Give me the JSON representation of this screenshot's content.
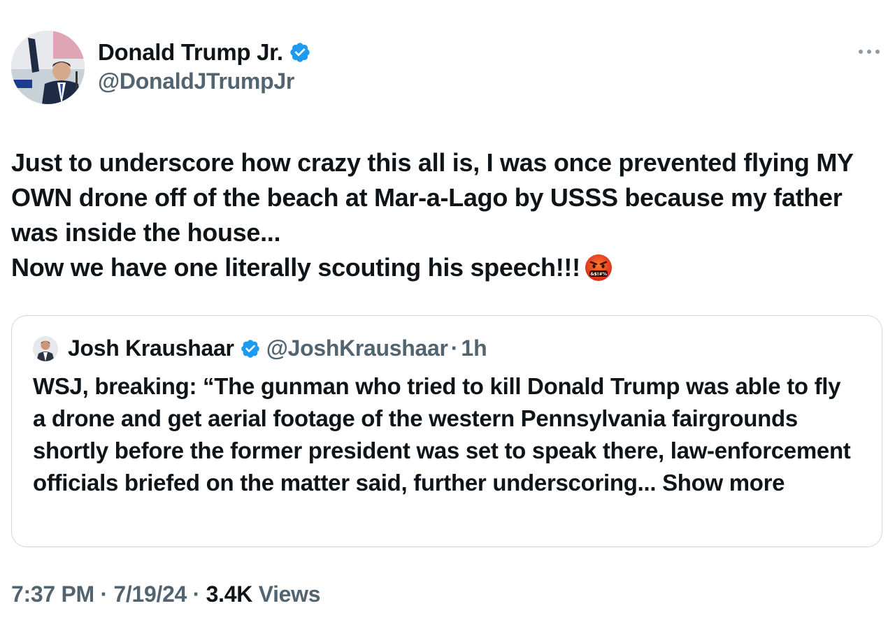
{
  "author": {
    "name": "Donald Trump Jr.",
    "handle": "@DonaldJTrumpJr",
    "verified": true,
    "avatar_icon": "profile-photo"
  },
  "tweet": {
    "lines": [
      "Just to underscore how crazy this all is, I was once prevented flying MY OWN drone off of the beach at Mar-a-Lago by USSS because my father was inside the house...",
      "Now we have one literally scouting his speech!!!"
    ],
    "emoji": "cursing-face-icon"
  },
  "quote": {
    "name": "Josh Kraushaar",
    "handle": "@JoshKraushaar",
    "separator": "·",
    "time": "1h",
    "verified": true,
    "text": "WSJ, breaking: “The gunman who tried to kill Donald Trump was able to fly a drone and get aerial footage of the western Pennsylvania fairgrounds shortly before the former president was set to speak there, law-enforcement officials briefed on the matter said, further underscoring...",
    "show_more": "Show more"
  },
  "meta": {
    "time": "7:37 PM",
    "sep1": "·",
    "date": "7/19/24",
    "sep2": "·",
    "views_count": "3.4K",
    "views_label": "Views"
  },
  "colors": {
    "verified_blue": "#1d9bf0",
    "secondary_text": "#536471",
    "border": "#cfd9de"
  }
}
